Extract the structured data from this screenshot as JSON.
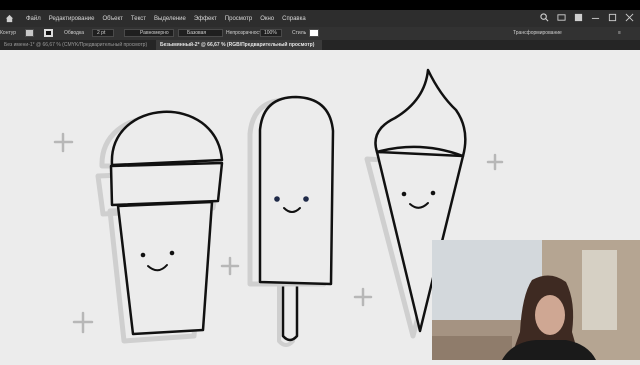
{
  "menu": [
    "Файл",
    "Редактирование",
    "Объект",
    "Текст",
    "Выделение",
    "Эффект",
    "Просмотр",
    "Окно",
    "Справка"
  ],
  "control": {
    "object_label": "Обводка",
    "stroke_value": "2 pt",
    "brush_value": "Равномерно",
    "basic_value": "Базовая",
    "opacity_label": "Непрозрачность",
    "opacity_value": "100%",
    "style_label": "Стиль",
    "transform_label": "Трансформирование"
  },
  "tabs": [
    {
      "label": "Без имени-1* @ 66,67 % (CMYK/Предварительный просмотр)",
      "active": false
    },
    {
      "label": "Безымянный-2* @ 66,67 % (RGB/Предварительный просмотр)",
      "active": true
    }
  ],
  "colors": {
    "canvas": "#ececec",
    "menubar": "#2d2d2d",
    "controlbar": "#323232",
    "ink": "#111111"
  }
}
